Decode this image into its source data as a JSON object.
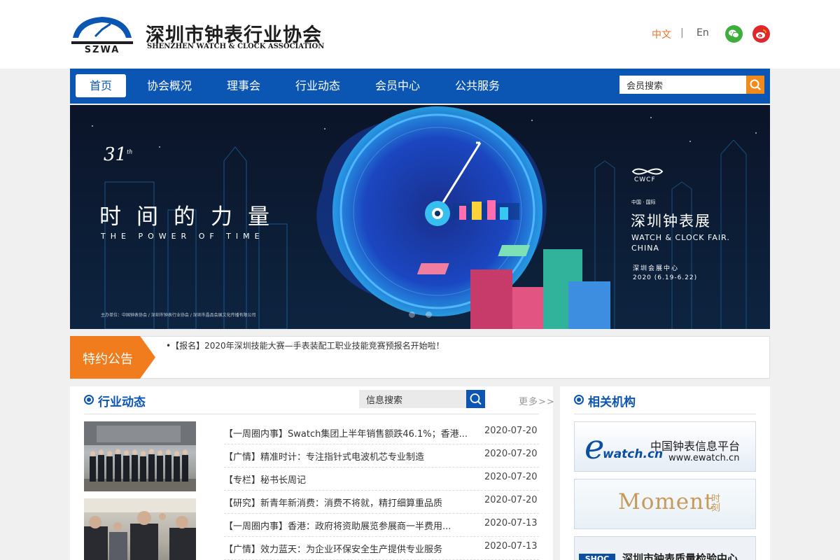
{
  "header": {
    "org_name_cn": "深圳市钟表行业协会",
    "org_name_en": "SHENZHEN WATCH & CLOCK ASSOCIATION",
    "lang_cn": "中文",
    "lang_sep": "|",
    "lang_en": "En",
    "icons": [
      "wechat-icon",
      "weibo-icon"
    ],
    "accent": "#e8702a"
  },
  "nav": {
    "items": [
      {
        "label": "首页",
        "active": true
      },
      {
        "label": "协会概况"
      },
      {
        "label": "理事会"
      },
      {
        "label": "行业动态"
      },
      {
        "label": "会员中心"
      },
      {
        "label": "公共服务"
      }
    ],
    "search_value": "会员搜索",
    "color": "#0c56b3"
  },
  "banner": {
    "anniversary": "31",
    "anniversary_suffix": "th",
    "title_cn": "时间的力量",
    "title_en": "THE POWER OF TIME",
    "host_line": "主办单位：中国钟表协会 / 深圳市钟表行业协会 / 深圳市晶品会展文化传播有限公司",
    "cwcf": "CWCF",
    "cn_intl": "中国 · 国际",
    "fair_cn": "深圳钟表展",
    "fair_en": "WATCH & CLOCK FAIR. CHINA",
    "venue": "深圳会展中心",
    "date": "2020 (6.19-6.22)"
  },
  "notice": {
    "tag": "特约公告",
    "text": "•【报名】2020年深圳技能大赛—手表装配工职业技能竞赛预报名开始啦！",
    "tag_color": "#f07c1e"
  },
  "news": {
    "title": "行业动态",
    "search_value": "信息搜索",
    "more": "更多>>",
    "items": [
      {
        "title": "【一周圈内事】Swatch集团上半年销售额跌46.1%；香港...",
        "date": "2020-07-20"
      },
      {
        "title": "【广情】精准时计：专注指针式电波机芯专业制造",
        "date": "2020-07-20"
      },
      {
        "title": "【专栏】秘书长周记",
        "date": "2020-07-20"
      },
      {
        "title": "【研究】新青年新消费：消费不将就，精打细算重品质",
        "date": "2020-07-20"
      },
      {
        "title": "【一周圈内事】香港：政府将资助展览参展商一半费用...",
        "date": "2020-07-13"
      },
      {
        "title": "【广情】效力蓝天：为企业环保安全生产提供专业服务",
        "date": "2020-07-13"
      }
    ]
  },
  "related": {
    "title": "相关机构",
    "cards": [
      {
        "logo_e": "e",
        "logo_watch": "watch.cn",
        "name": "中国钟表信息平台",
        "url": "www.ewatch.cn"
      },
      {
        "name": "Moment",
        "name_cn": "时刻"
      },
      {
        "logo": "SHQC",
        "name": "深圳市钟表质量检验中心"
      }
    ]
  }
}
